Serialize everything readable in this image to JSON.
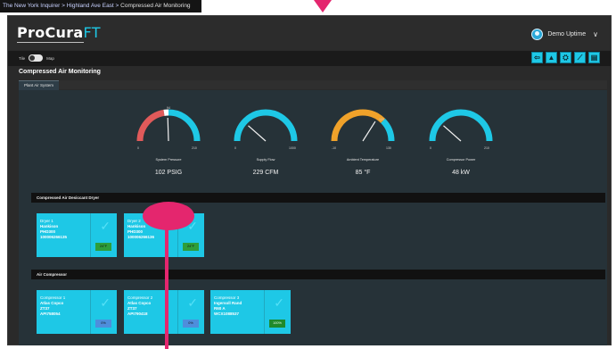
{
  "breadcrumb": {
    "items": [
      "The New York Inquirer",
      "Highland Ave East",
      "Compressed Air Monitoring"
    ],
    "sep": " >"
  },
  "app": {
    "logo_main": "ProCura",
    "logo_suffix": "FT",
    "user_name": "Demo Uptime",
    "colors": {
      "accent": "#1ec8e6",
      "background": "#2a2a2a",
      "panel": "#263238",
      "pointer": "#e4266e"
    }
  },
  "toolbar": {
    "toggle_left": "Tile",
    "toggle_right": "Map",
    "tools": [
      {
        "icon": "back-arrow-icon",
        "glyph": "⇦"
      },
      {
        "icon": "alert-triangle-icon",
        "glyph": "▲"
      },
      {
        "icon": "hierarchy-icon",
        "glyph": "⛭"
      },
      {
        "icon": "trend-chart-icon",
        "glyph": "⟋"
      },
      {
        "icon": "report-icon",
        "glyph": "▤"
      }
    ]
  },
  "page": {
    "title": "Compressed Air Monitoring",
    "tab": "Plant Air System"
  },
  "gauges": [
    {
      "label": "System Pressure",
      "value": "102 PSIG",
      "min": "0",
      "max": "210",
      "setpoint": "94",
      "fraction": 0.49,
      "scheme": "pressure"
    },
    {
      "label": "Supply Flow",
      "value": "229 CFM",
      "min": "0",
      "max": "1000",
      "fraction": 0.23,
      "scheme": "plain"
    },
    {
      "label": "Ambient Temperature",
      "value": "85 °F",
      "min": "-10",
      "max": "130",
      "setpoint": "100",
      "fraction": 0.68,
      "scheme": "temp"
    },
    {
      "label": "Compressor Power",
      "value": "48 kW",
      "min": "0",
      "max": "210",
      "fraction": 0.23,
      "scheme": "plain"
    }
  ],
  "dryers": {
    "header": "Compressed Air Desiccant Dryer",
    "cards": [
      {
        "title": "Dryer 1",
        "make": "Hankison",
        "model": "PHD300",
        "serial": "100006266135",
        "badge": "24°F",
        "badge_color": "green"
      },
      {
        "title": "Dryer 2",
        "make": "Hankison",
        "model": "PHD300",
        "serial": "100006266136",
        "badge": "24°F",
        "badge_color": "green"
      }
    ]
  },
  "compressors": {
    "header": "Air Compressor",
    "cards": [
      {
        "title": "Compressor 1",
        "make": "Atlas Copco",
        "model": "ZT37",
        "serial": "API758054",
        "badge": "0%",
        "badge_color": "blue"
      },
      {
        "title": "Compressor 2",
        "make": "Atlas Copco",
        "model": "ZT37",
        "serial": "API790418",
        "badge": "0%",
        "badge_color": "blue"
      },
      {
        "title": "Compressor 3",
        "make": "Ingersoll Rand",
        "model": "R60 A",
        "serial": "WCX1088537",
        "badge": "100%",
        "badge_color": "darkgreen"
      }
    ]
  }
}
